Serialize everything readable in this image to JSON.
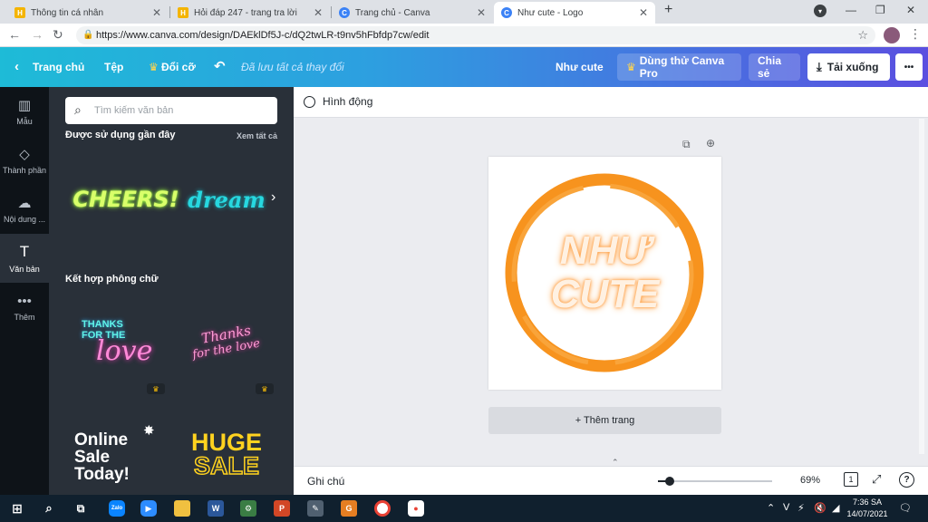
{
  "browser": {
    "tabs": [
      {
        "title": "Thông tin cá nhân",
        "icon": "h-logo-icon",
        "color": "#f4b400"
      },
      {
        "title": "Hỏi đáp 247 - trang tra lời",
        "icon": "h-logo-icon",
        "color": "#f4b400"
      },
      {
        "title": "Trang chủ - Canva",
        "icon": "canva-icon",
        "color": "#3b82f6"
      },
      {
        "title": "Như cute - Logo",
        "icon": "canva-icon",
        "color": "#3b82f6"
      }
    ],
    "new_tab": "+",
    "url": "https://www.canva.com/design/DAEklDf5J-c/dQ2twLR-t9nv5hFbfdp7cw/edit"
  },
  "header": {
    "home": "Trang chủ",
    "file": "Tệp",
    "resize": "Đổi cỡ",
    "saved": "Đã lưu tất cả thay đổi",
    "design_name": "Như cute",
    "try_pro": "Dùng thử Canva Pro",
    "share": "Chia sẻ",
    "download": "Tải xuống",
    "more": "•••",
    "accent": "#8b3dff"
  },
  "sidebar": {
    "items": [
      {
        "label": "Mẫu",
        "icon": "layout-icon"
      },
      {
        "label": "Thành phần",
        "icon": "shapes-icon"
      },
      {
        "label": "Nội dung ...",
        "icon": "upload-icon"
      },
      {
        "label": "Văn bản",
        "icon": "text-icon"
      },
      {
        "label": "Thêm",
        "icon": "more-icon"
      }
    ]
  },
  "panel": {
    "search_placeholder": "Tìm kiếm văn bản",
    "recent_title": "Được sử dụng gần đây",
    "see_all": "Xem tất cả",
    "recent": [
      "CHEERS!",
      "dream"
    ],
    "combos_title": "Kết hợp phông chữ",
    "combo1_line1": "THANKS",
    "combo1_line2": "FOR THE",
    "combo1_line3": "love",
    "combo2_line1": "Thanks",
    "combo2_line2": "for the love",
    "combo3_line1": "Online",
    "combo3_line2": "Sale",
    "combo3_line3": "Today!",
    "combo4_line1": "HUGE",
    "combo4_line2": "SALE"
  },
  "canvas": {
    "animate": "Hình động",
    "logo_line1": "NHƯ",
    "logo_line2": "CUTE",
    "add_page": "+ Thêm trang",
    "notes": "Ghi chú",
    "zoom": "69%",
    "zoom_value": 0.69,
    "page_count": "1",
    "help": "?"
  },
  "taskbar": {
    "time": "7:36 SA",
    "date": "14/07/2021",
    "lang": "V"
  }
}
